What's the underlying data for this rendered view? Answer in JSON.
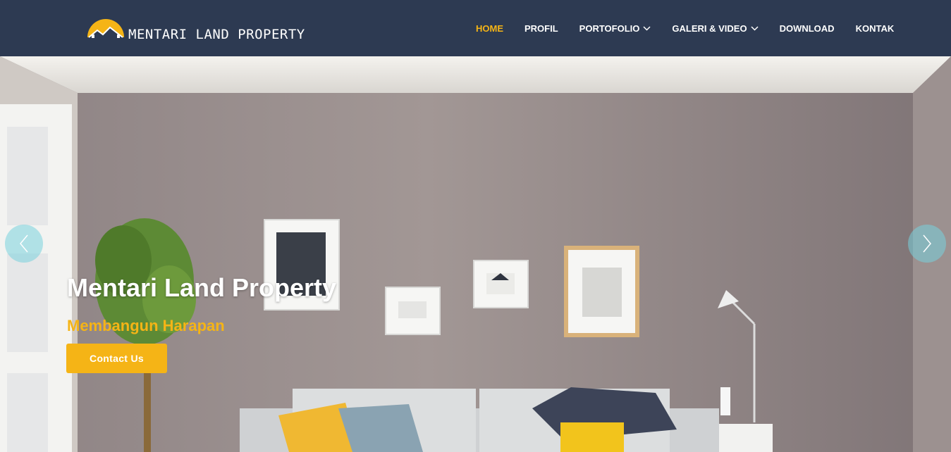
{
  "brand": {
    "name": "MENTARI LAND PROPERTY",
    "logo_icon": "sun-over-roofs-logo",
    "accent_color": "#f5b416",
    "header_color": "#2d3a52"
  },
  "nav": {
    "items": [
      {
        "label": "HOME",
        "active": true,
        "has_dropdown": false
      },
      {
        "label": "PROFIL",
        "active": false,
        "has_dropdown": false
      },
      {
        "label": "PORTOFOLIO",
        "active": false,
        "has_dropdown": true
      },
      {
        "label": "GALERI & VIDEO",
        "active": false,
        "has_dropdown": true
      },
      {
        "label": "DOWNLOAD",
        "active": false,
        "has_dropdown": false
      },
      {
        "label": "KONTAK",
        "active": false,
        "has_dropdown": false
      }
    ]
  },
  "hero": {
    "title": "Mentari Land Property",
    "subtitle": "Membangun Harapan",
    "cta_label": "Contact Us",
    "prev_icon": "chevron-left-icon",
    "next_icon": "chevron-right-icon"
  }
}
